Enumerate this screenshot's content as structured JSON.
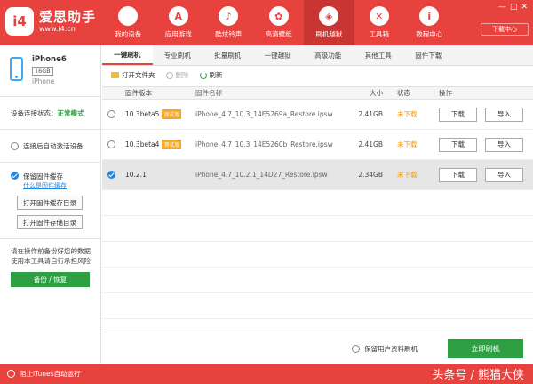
{
  "app": {
    "title": "爱思助手",
    "url": "www.i4.cn",
    "logo_mark": "i4"
  },
  "nav": [
    {
      "label": "我的设备",
      "icon": "apple-icon",
      "glyph": ""
    },
    {
      "label": "应用游戏",
      "icon": "app-store-icon",
      "glyph": "A"
    },
    {
      "label": "酷炫铃声",
      "icon": "bell-icon",
      "glyph": "♪"
    },
    {
      "label": "高清壁纸",
      "icon": "flower-icon",
      "glyph": "✿"
    },
    {
      "label": "刷机越狱",
      "icon": "dropbox-icon",
      "glyph": "◈"
    },
    {
      "label": "工具箱",
      "icon": "tools-icon",
      "glyph": "✕"
    },
    {
      "label": "教程中心",
      "icon": "tutorial-icon",
      "glyph": "i"
    }
  ],
  "window": {
    "minimize": "—",
    "maximize": "□",
    "close": "✕",
    "download_center": "下载中心"
  },
  "device": {
    "name": "iPhone6",
    "capacity": "16GB",
    "type": "iPhone"
  },
  "sidebar": {
    "conn_label": "设备连接状态：",
    "conn_value": "正常模式",
    "auto_activate": "连接后自动激活设备",
    "keep_cache": "保留固件缓存",
    "what_is_cache": "什么是固件缓存",
    "open_cache_dir": "打开固件缓存目录",
    "open_store_dir": "打开固件存储目录",
    "tip_line1": "请在操作前备份好您的数据",
    "tip_line2": "使用本工具请自行承担风险",
    "backup_btn": "备份 / 恢复"
  },
  "tabs": [
    "一键刷机",
    "专业刷机",
    "批量刷机",
    "一键越狱",
    "高级功能",
    "其他工具",
    "固件下载"
  ],
  "toolbar": {
    "open_folder": "打开文件夹",
    "delete": "删除",
    "refresh": "刷新"
  },
  "table": {
    "headers": {
      "version": "固件版本",
      "name": "固件名称",
      "size": "大小",
      "status": "状态",
      "ops": "操作"
    },
    "rows": [
      {
        "version": "10.3beta5",
        "badge": "测试版",
        "name": "iPhone_4.7_10.3_14E5269a_Restore.ipsw",
        "size": "2.41GB",
        "status": "未下载",
        "download": "下载",
        "import": "导入"
      },
      {
        "version": "10.3beta4",
        "badge": "测试版",
        "name": "iPhone_4.7_10.3_14E5260b_Restore.ipsw",
        "size": "2.41GB",
        "status": "未下载",
        "download": "下载",
        "import": "导入"
      },
      {
        "version": "10.2.1",
        "badge": "",
        "name": "iPhone_4.7_10.2.1_14D27_Restore.ipsw",
        "size": "2.34GB",
        "status": "未下载",
        "download": "下载",
        "import": "导入"
      }
    ]
  },
  "bottom": {
    "keep_data": "保留用户资料刷机",
    "flash_now": "立即刷机"
  },
  "footer": {
    "block_itunes": "阻止iTunes自动运行",
    "watermark": "头条号 / 熊猫大侠"
  },
  "colors": {
    "brand_red": "#e8423f",
    "green": "#2ea043",
    "status_orange": "#f39c12",
    "badge_orange": "#f5a623",
    "selected_blue": "#1e88e5"
  }
}
